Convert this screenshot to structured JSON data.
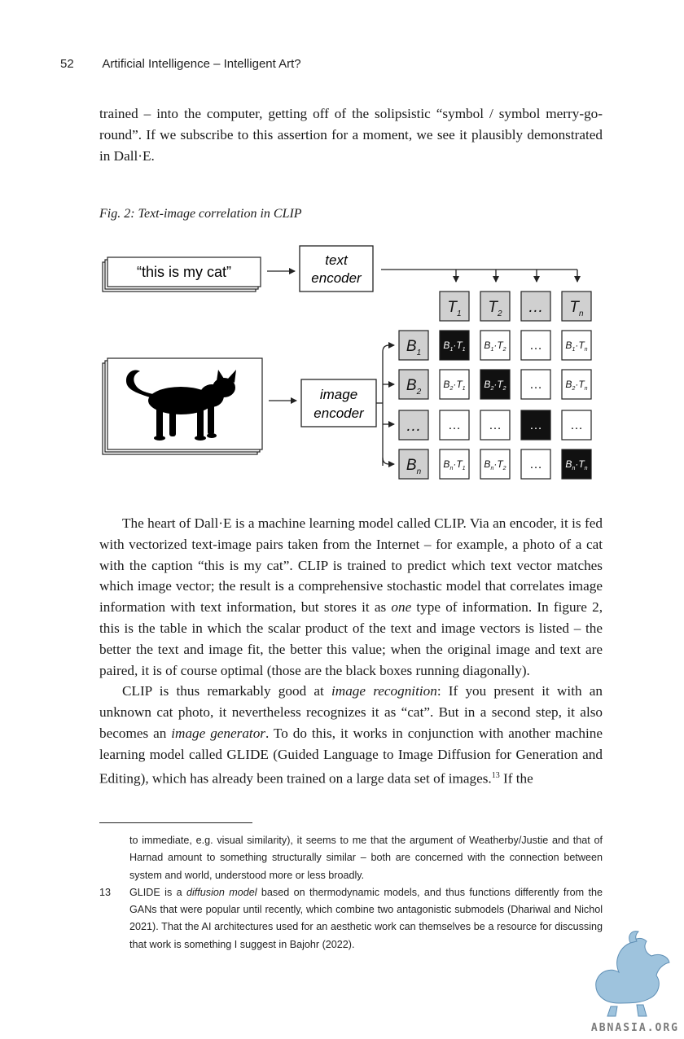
{
  "header": {
    "page_number": "52",
    "running_title": "Artificial Intelligence – Intelligent Art?"
  },
  "top_paragraph": "trained – into the computer, getting off of the solipsistic “symbol / symbol merry-go-round”. If we subscribe to this assertion for a moment, we see it plausibly demonstrated in Dall·E.",
  "figure": {
    "caption": "Fig. 2: Text-image correlation in CLIP",
    "text_input": "“this is my cat”",
    "text_encoder": [
      "text",
      "encoder"
    ],
    "image_encoder": [
      "image",
      "encoder"
    ],
    "dots": "…",
    "T_labels": [
      [
        "T",
        "1"
      ],
      [
        "T",
        "2"
      ],
      [
        "…",
        ""
      ],
      [
        "T",
        "n"
      ]
    ],
    "B_labels": [
      [
        "B",
        "1"
      ],
      [
        "B",
        "2"
      ],
      [
        "…",
        ""
      ],
      [
        "B",
        "n"
      ]
    ],
    "matrix": [
      [
        [
          "1",
          "1",
          true
        ],
        [
          "1",
          "2",
          false
        ],
        null,
        [
          "1",
          "n",
          false
        ]
      ],
      [
        [
          "2",
          "1",
          false
        ],
        [
          "2",
          "2",
          true
        ],
        null,
        [
          "2",
          "n",
          false
        ]
      ],
      [
        "dots",
        "dots",
        "dark-dots",
        "dots"
      ],
      [
        [
          "n",
          "1",
          false
        ],
        [
          "n",
          "2",
          false
        ],
        null,
        [
          "n",
          "n",
          true
        ]
      ]
    ],
    "colors": {
      "dark": "#111111",
      "grey": "#d0d0d0",
      "line": "#222222"
    }
  },
  "main": {
    "p1": "The heart of Dall·E is a machine learning model called CLIP. Via an encoder, it is fed with vectorized text-image pairs taken from the Internet – for example, a photo of a cat with the caption “this is my cat”. CLIP is trained to predict which text vector matches which image vector; the result is a comprehensive stochastic model that correlates image information with text information, but stores it as ",
    "p1_em": "one",
    "p1_end": " type of information. In figure 2, this is the table in which the scalar product of the text and image vectors is listed – the better the text and image fit, the better this value; when the original image and text are paired, it is of course optimal (those are the black boxes running diagonally).",
    "p2_a": "CLIP is thus remarkably good at ",
    "p2_em1": "image recognition",
    "p2_b": ": If you present it with an unknown cat photo, it nevertheless recognizes it as “cat”. But in a second step, it also becomes an ",
    "p2_em2": "image generator",
    "p2_c": ". To do this, it works in conjunction with another machine learning model called GLIDE (Guided Language to Image Diffusion for Generation and Editing), which has already been trained on a large data set of images.",
    "p2_sup": "13",
    "p2_end": " If the"
  },
  "footnotes": {
    "cont": "to immediate, e.g. visual similarity), it seems to me that the argument of Weatherby/Justie and that of Harnad amount to something structurally similar – both are concerned with the connection between system and world, understood more or less broadly.",
    "fn13_num": "13",
    "fn13_a": "GLIDE is a ",
    "fn13_em": "diffusion model",
    "fn13_b": " based on thermodynamic models, and thus functions differently from the GANs that were popular until recently, which combine two antagonistic submodels (Dhariwal and Nichol 2021). That the AI architectures used for an aesthetic work can themselves be a resource for discussing that work is something I suggest in Bajohr (2022)."
  },
  "watermark": {
    "text": "ABNASIA.ORG",
    "icon": "griffin-logo-icon"
  }
}
